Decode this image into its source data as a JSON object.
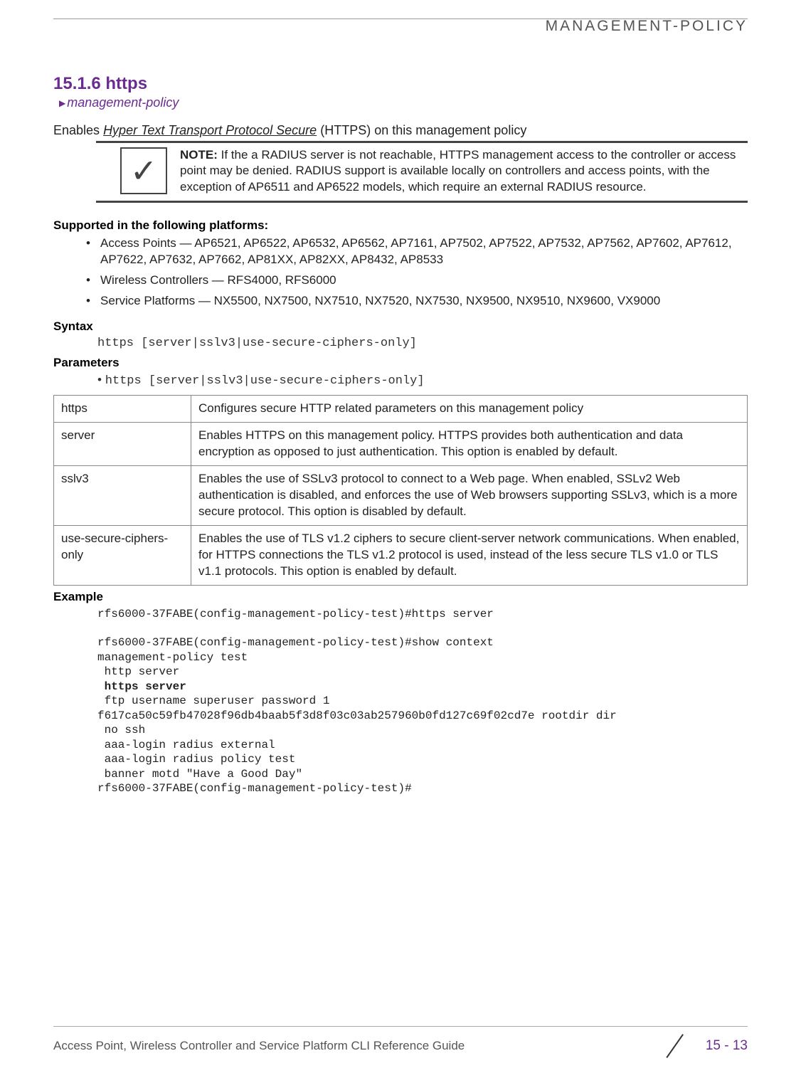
{
  "running_head": "MANAGEMENT-POLICY",
  "section_number": "15.1.6 https",
  "breadcrumb": "management-policy",
  "lead_plain_prefix": "Enables ",
  "lead_italic": "Hyper Text Transport Protocol Secure",
  "lead_plain_suffix": " (HTTPS) on this management policy",
  "note_label": "NOTE:",
  "note_body": "If the a RADIUS server is not reachable, HTTPS management access to the controller or access point may be denied. RADIUS support is available locally on controllers and access points, with the exception of AP6511 and AP6522 models, which require an external RADIUS resource.",
  "supported_heading": "Supported in the following platforms:",
  "platforms": [
    "Access Points — AP6521, AP6522, AP6532, AP6562, AP7161, AP7502, AP7522, AP7532, AP7562, AP7602, AP7612, AP7622, AP7632, AP7662, AP81XX, AP82XX, AP8432, AP8533",
    "Wireless Controllers — RFS4000, RFS6000",
    "Service Platforms — NX5500, NX7500, NX7510, NX7520, NX7530, NX9500, NX9510, NX9600, VX9000"
  ],
  "syntax_heading": "Syntax",
  "syntax_code": "https [server|sslv3|use-secure-ciphers-only]",
  "parameters_heading": "Parameters",
  "parameters_code": "https [server|sslv3|use-secure-ciphers-only]",
  "param_rows": [
    {
      "k": "https",
      "v": "Configures secure HTTP related parameters on this management policy"
    },
    {
      "k": "server",
      "v": "Enables HTTPS on this management policy. HTTPS provides both authentication and data encryption as opposed to just authentication. This option is enabled by default."
    },
    {
      "k": "sslv3",
      "v": "Enables the use of SSLv3 protocol to connect to a Web page. When enabled, SSLv2 Web authentication is disabled, and enforces the use of Web browsers supporting SSLv3, which is a more secure protocol. This option is disabled by default."
    },
    {
      "k": "use-secure-ciphers-only",
      "v": "Enables the use of TLS v1.2 ciphers to secure client-server network communications. When enabled, for HTTPS connections the TLS v1.2 protocol is used, instead of the less secure TLS v1.0 or TLS v1.1 protocols. This option is enabled by default."
    }
  ],
  "example_heading": "Example",
  "example_lines": {
    "l01": "rfs6000-37FABE(config-management-policy-test)#https server",
    "l02": "",
    "l03": "rfs6000-37FABE(config-management-policy-test)#show context",
    "l04": "management-policy test",
    "l05": " http server",
    "l06_bold": " https server",
    "l07": " ftp username superuser password 1 ",
    "l08": "f617ca50c59fb47028f96db4baab5f3d8f03c03ab257960b0fd127c69f02cd7e rootdir dir",
    "l09": " no ssh",
    "l10": " aaa-login radius external",
    "l11": " aaa-login radius policy test",
    "l12": " banner motd \"Have a Good Day\"",
    "l13": "rfs6000-37FABE(config-management-policy-test)#"
  },
  "footer_left": "Access Point, Wireless Controller and Service Platform CLI Reference Guide",
  "page_number": "15 - 13"
}
